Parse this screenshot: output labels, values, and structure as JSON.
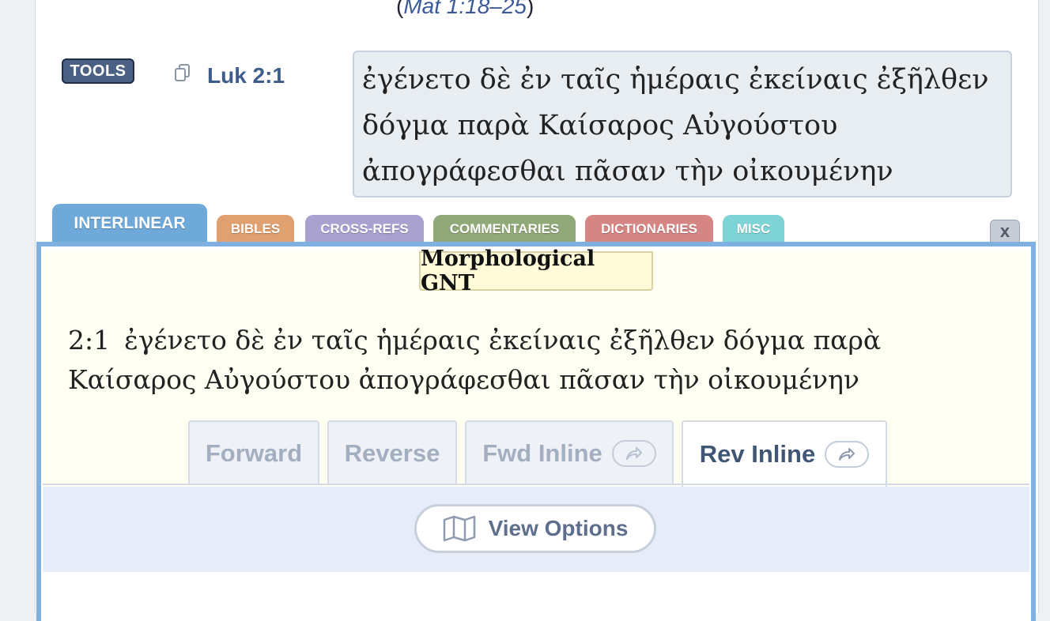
{
  "header": {
    "cross_ref_open": "(",
    "cross_ref": "Mat 1:18–25",
    "cross_ref_close": ")"
  },
  "verse": {
    "tools_label": "TOOLS",
    "reference": "Luk 2:1",
    "text": "ἐγένετο δὲ ἐν ταῖς ἡμέραις ἐκείναις ἐξῆλθεν δόγμα παρὰ Καίσαρος Αὐγούστου ἀπογράφεσθαι πᾶσαν τὴν οἰκουμένην"
  },
  "tabs": [
    {
      "label": "INTERLINEAR",
      "color": "#6ea9da",
      "active": true
    },
    {
      "label": "BIBLES",
      "color": "#e0a06f"
    },
    {
      "label": "CROSS-REFS",
      "color": "#a9a1cf"
    },
    {
      "label": "COMMENTARIES",
      "color": "#91a978"
    },
    {
      "label": "DICTIONARIES",
      "color": "#d68585"
    },
    {
      "label": "MISC",
      "color": "#7dd3d6"
    }
  ],
  "close_label": "x",
  "panel": {
    "module_title": "Morphological GNT",
    "verse_number": "2:1",
    "text": "ἐγένετο δὲ ἐν ταῖς ἡμέραις ἐκείναις ἐξῆλθεν δόγμα παρὰ Καίσαρος Αὐγούστου ἀπογράφεσθαι πᾶσαν τὴν οἰκουμένην",
    "subtabs": [
      "Forward",
      "Reverse",
      "Fwd Inline",
      "Rev Inline"
    ],
    "active_subtab": "Rev Inline",
    "view_options_label": "View Options"
  },
  "icons": {
    "copy": "copy-icon",
    "share": "share-arrow-icon",
    "map": "map-icon"
  }
}
